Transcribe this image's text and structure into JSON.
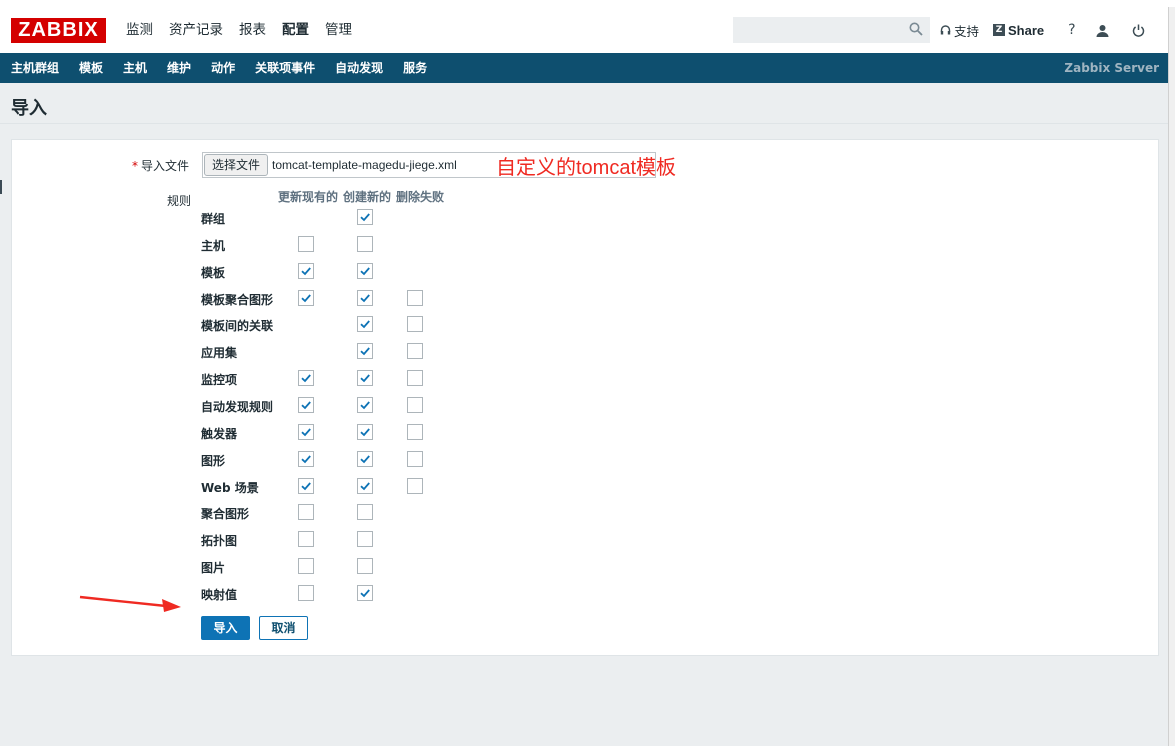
{
  "header": {
    "logo": "ZABBIX",
    "nav": [
      "监测",
      "资产记录",
      "报表",
      "配置",
      "管理"
    ],
    "active_nav": "配置",
    "search": {
      "value": "",
      "placeholder": ""
    },
    "support_label": "支持",
    "share_label": "Share",
    "help_label": "?"
  },
  "subnav": {
    "items": [
      "主机群组",
      "模板",
      "主机",
      "维护",
      "动作",
      "关联项事件",
      "自动发现",
      "服务"
    ],
    "server_name": "Zabbix Server"
  },
  "page": {
    "title": "导入"
  },
  "form": {
    "file_label": "导入文件",
    "required_mark": "*",
    "file_button": "选择文件",
    "file_name": "tomcat-template-magedu-jiege.xml",
    "annotation": "自定义的tomcat模板",
    "rules_label": "规则",
    "columns": [
      "更新现有的",
      "创建新的",
      "删除失败"
    ],
    "rules": [
      {
        "label": "群组",
        "update": null,
        "create": true,
        "delete": null
      },
      {
        "label": "主机",
        "update": false,
        "create": false,
        "delete": null
      },
      {
        "label": "模板",
        "update": true,
        "create": true,
        "delete": null
      },
      {
        "label": "模板聚合图形",
        "update": true,
        "create": true,
        "delete": false
      },
      {
        "label": "模板间的关联",
        "update": null,
        "create": true,
        "delete": false
      },
      {
        "label": "应用集",
        "update": null,
        "create": true,
        "delete": false
      },
      {
        "label": "监控项",
        "update": true,
        "create": true,
        "delete": false
      },
      {
        "label": "自动发现规则",
        "update": true,
        "create": true,
        "delete": false
      },
      {
        "label": "触发器",
        "update": true,
        "create": true,
        "delete": false
      },
      {
        "label": "图形",
        "update": true,
        "create": true,
        "delete": false
      },
      {
        "label": "Web 场景",
        "update": true,
        "create": true,
        "delete": false
      },
      {
        "label": "聚合图形",
        "update": false,
        "create": false,
        "delete": null
      },
      {
        "label": "拓扑图",
        "update": false,
        "create": false,
        "delete": null
      },
      {
        "label": "图片",
        "update": false,
        "create": false,
        "delete": null
      },
      {
        "label": "映射值",
        "update": false,
        "create": true,
        "delete": null
      }
    ],
    "import_button": "导入",
    "cancel_button": "取消"
  },
  "colors": {
    "brand": "#d40000",
    "nav_bg": "#0e4f6f",
    "primary": "#0e73b5",
    "annotation": "#ef2a22"
  }
}
